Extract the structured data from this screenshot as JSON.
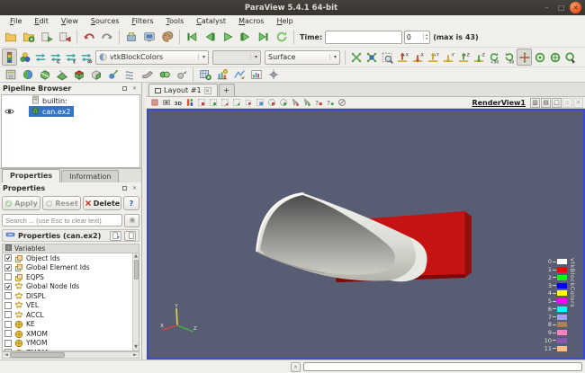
{
  "window": {
    "title": "ParaView 5.4.1 64-bit",
    "minimize_glyph": "–",
    "maximize_glyph": "▢",
    "close_glyph": "✕"
  },
  "menu": {
    "items": [
      "File",
      "Edit",
      "View",
      "Sources",
      "Filters",
      "Tools",
      "Catalyst",
      "Macros",
      "Help"
    ]
  },
  "toolbar_main": {
    "file_icons": [
      "open-icon",
      "open-advanced-icon",
      "load-state-icon",
      "save-state-icon"
    ],
    "edit_icons": [
      "undo-icon",
      "redo-icon"
    ],
    "misc_icons": [
      "auto-apply-icon",
      "screenshot-icon",
      "color-palette-icon"
    ],
    "vcr_icons": [
      "first-frame-icon",
      "previous-frame-icon",
      "play-icon",
      "next-frame-icon",
      "last-frame-icon",
      "loop-icon"
    ],
    "time_label": "Time:",
    "time_field_value": "",
    "time_spin_value": "0",
    "time_max_note": "(max is 43)"
  },
  "toolbar_color": {
    "icons": [
      "edit-color-map-icon",
      "choose-color-palette-icon",
      "rescale-to-data-icon",
      "rescale-to-custom-icon",
      "rescale-to-temporal-icon",
      "rescale-to-visible-icon"
    ],
    "color_by_value": "vtkBlockColors",
    "component_value": "",
    "representation_value": "Surface"
  },
  "toolbar_camera": {
    "icons": [
      "reset-camera-icon",
      "zoom-to-data-icon",
      "zoom-to-box-icon",
      "view-plus-x-icon",
      "view-minus-x-icon",
      "view-plus-y-icon",
      "view-minus-y-icon",
      "view-plus-z-icon",
      "view-minus-z-icon",
      "rotate-90-cw-icon",
      "rotate-90-ccw-icon",
      "show-center-axes-icon",
      "pick-center-icon",
      "reset-center-icon",
      "adjust-camera-icon"
    ]
  },
  "toolbar_filters": {
    "icons": [
      "calculator-icon",
      "contour-icon",
      "clip-icon",
      "slice-icon",
      "threshold-icon",
      "extract-subset-icon",
      "glyph-icon",
      "stream-tracer-icon",
      "warp-vector-icon",
      "group-datasets-icon",
      "extract-level-icon"
    ]
  },
  "toolbar_data": {
    "icons": [
      "spreadsheet-view-icon",
      "quartile-chart-icon",
      "plot-over-line-icon",
      "histogram-icon",
      "probe-location-icon"
    ]
  },
  "toggled_icons": [
    "edit-color-map-icon",
    "show-center-axes-icon"
  ],
  "pipeline": {
    "title": "Pipeline Browser",
    "server_label": "builtin:",
    "item_label": "can.ex2"
  },
  "panel_tabs": {
    "properties": "Properties",
    "information": "Information"
  },
  "properties": {
    "dock_title": "Properties",
    "apply_label": "Apply",
    "reset_label": "Reset",
    "delete_label": "Delete",
    "help_label": "?",
    "search_placeholder": "Search ... (use Esc to clear text)",
    "section_title": "Properties (can.ex2)",
    "variables_title": "Variables",
    "variables": [
      {
        "label": "Object Ids",
        "checked": true,
        "type": "cell"
      },
      {
        "label": "Global Element Ids",
        "checked": true,
        "type": "cell"
      },
      {
        "label": "EQPS",
        "checked": false,
        "type": "cell"
      },
      {
        "label": "Global Node Ids",
        "checked": true,
        "type": "point"
      },
      {
        "label": "DISPL",
        "checked": false,
        "type": "point"
      },
      {
        "label": "VEL",
        "checked": false,
        "type": "point"
      },
      {
        "label": "ACCL",
        "checked": false,
        "type": "point"
      },
      {
        "label": "KE",
        "checked": false,
        "type": "global"
      },
      {
        "label": "XMOM",
        "checked": false,
        "type": "global"
      },
      {
        "label": "YMOM",
        "checked": false,
        "type": "global"
      },
      {
        "label": "ZMOM",
        "checked": false,
        "type": "global"
      }
    ]
  },
  "layout": {
    "tab_label": "Layout #1",
    "tab_close_glyph": "✕",
    "new_tab_label": "+"
  },
  "view_header": {
    "view_name": "RenderView1",
    "buttons": [
      "split-horizontal-icon",
      "split-vertical-icon",
      "maximize-icon",
      "undock-icon",
      "close-icon"
    ]
  },
  "view_toolbar": {
    "icons": [
      "export-scene-icon",
      "capture-screenshot-icon",
      "toggle-interaction-mode-icon",
      "adjust-color-legend-icon",
      "select-cells-rect-icon",
      "select-points-rect-icon",
      "select-frustum-cells-icon",
      "select-frustum-points-icon",
      "select-polygon-cells-icon",
      "select-block-icon",
      "select-cells-surface-icon",
      "select-points-surface-icon",
      "interactive-select-cells-icon",
      "interactive-select-points-icon",
      "hover-cells-icon",
      "hover-points-icon",
      "clear-selection-icon"
    ]
  },
  "render_view": {
    "background_color": "#595d73",
    "border_color": "#3c49d4",
    "legend": {
      "title": "vtkBlockColors",
      "entries": [
        {
          "label": "0",
          "color": "#ffffff"
        },
        {
          "label": "1",
          "color": "#ff0000"
        },
        {
          "label": "2",
          "color": "#00ff00"
        },
        {
          "label": "3",
          "color": "#0000ff"
        },
        {
          "label": "4",
          "color": "#ffff00"
        },
        {
          "label": "5",
          "color": "#ff00ff"
        },
        {
          "label": "6",
          "color": "#00ffff"
        },
        {
          "label": "7",
          "color": "#a1a1ff"
        },
        {
          "label": "8",
          "color": "#ab8055"
        },
        {
          "label": "9",
          "color": "#ff80bf"
        },
        {
          "label": "10",
          "color": "#8759b3"
        },
        {
          "label": "11",
          "color": "#ffbf80"
        }
      ]
    },
    "orientation_axes": {
      "x_label": "X",
      "y_label": "Y",
      "z_label": "Z"
    }
  }
}
